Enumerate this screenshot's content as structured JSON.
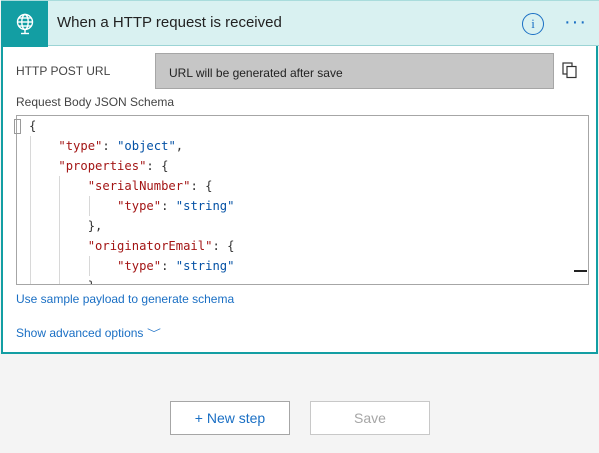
{
  "header": {
    "title": "When a HTTP request is received",
    "info_label": "i",
    "more_label": "···"
  },
  "fields": {
    "url_label": "HTTP POST URL",
    "url_value": "URL will be generated after save",
    "schema_label": "Request Body JSON Schema"
  },
  "schema_code": {
    "lines": [
      [
        {
          "t": "{",
          "c": "p"
        }
      ],
      [
        {
          "t": "    ",
          "c": "p"
        },
        {
          "t": "\"type\"",
          "c": "k"
        },
        {
          "t": ": ",
          "c": "p"
        },
        {
          "t": "\"object\"",
          "c": "s"
        },
        {
          "t": ",",
          "c": "p"
        }
      ],
      [
        {
          "t": "    ",
          "c": "p"
        },
        {
          "t": "\"properties\"",
          "c": "k"
        },
        {
          "t": ": {",
          "c": "p"
        }
      ],
      [
        {
          "t": "        ",
          "c": "p"
        },
        {
          "t": "\"serialNumber\"",
          "c": "k"
        },
        {
          "t": ": {",
          "c": "p"
        }
      ],
      [
        {
          "t": "            ",
          "c": "p"
        },
        {
          "t": "\"type\"",
          "c": "k"
        },
        {
          "t": ": ",
          "c": "p"
        },
        {
          "t": "\"string\"",
          "c": "s"
        }
      ],
      [
        {
          "t": "        },",
          "c": "p"
        }
      ],
      [
        {
          "t": "        ",
          "c": "p"
        },
        {
          "t": "\"originatorEmail\"",
          "c": "k"
        },
        {
          "t": ": {",
          "c": "p"
        }
      ],
      [
        {
          "t": "            ",
          "c": "p"
        },
        {
          "t": "\"type\"",
          "c": "k"
        },
        {
          "t": ": ",
          "c": "p"
        },
        {
          "t": "\"string\"",
          "c": "s"
        }
      ],
      [
        {
          "t": "        },",
          "c": "p"
        }
      ],
      [
        {
          "t": "        ",
          "c": "p"
        },
        {
          "t": "\"",
          "c": "k"
        }
      ]
    ]
  },
  "links": {
    "sample_payload": "Use sample payload to generate schema",
    "advanced": "Show advanced options"
  },
  "actions": {
    "new_step": "+ New step",
    "save": "Save"
  },
  "colors": {
    "accent": "#139ea3",
    "header_bg": "#d9f1f1",
    "link": "#1a6fc4",
    "json_key": "#a31515",
    "json_string": "#0451a5"
  },
  "icons": {
    "trigger": "globe-icon",
    "info": "info-icon",
    "more": "ellipsis-icon",
    "copy": "copy-icon",
    "chevron": "chevron-down-icon"
  }
}
